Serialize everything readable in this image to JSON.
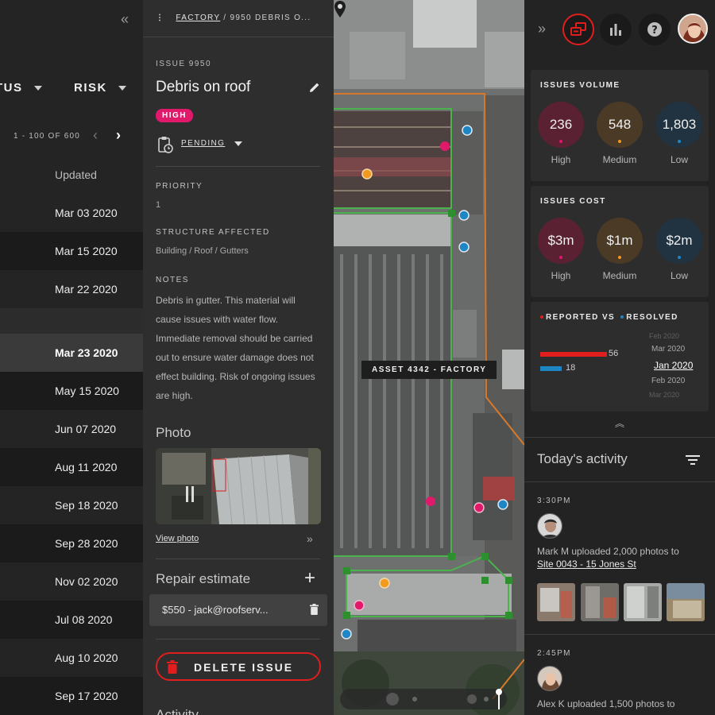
{
  "table": {
    "collapse_icon": "double-chevron-left-icon",
    "columns": [
      "TUS",
      "RISK"
    ],
    "pager_text": "1 - 100 OF 600",
    "updated_header": "Updated",
    "rows": [
      "Mar 03 2020",
      "Mar 15  2020",
      "Mar 22 2020",
      "",
      "Mar 23 2020",
      "May 15 2020",
      "Jun 07 2020",
      "Aug 11 2020",
      "Sep 18 2020",
      "Sep 28 2020",
      "Nov 02 2020",
      "Jul 08 2020",
      "Aug 10 2020",
      "Sep 17 2020"
    ],
    "selected_row": "Mar 23 2020"
  },
  "issue": {
    "breadcrumb_root": "FACTORY",
    "breadcrumb_current": "/ 9950 DEBRIS O...",
    "number": "ISSUE 9950",
    "title": "Debris on roof",
    "risk_badge": "HIGH",
    "status": "PENDING",
    "priority_label": "PRIORITY",
    "priority_value": "1",
    "structure_label": "STRUCTURE AFFECTED",
    "structure_value": "Building / Roof / Gutters",
    "notes_label": "NOTES",
    "notes": "Debris in gutter. This material will cause issues with water flow. Immediate removal should be carried out to ensure water damage does not effect building. Risk of ongoing issues are high.",
    "photo_heading": "Photo",
    "view_photo": "View photo",
    "repair_heading": "Repair estimate",
    "repair_item": "$550 - jack@roofserv...",
    "delete_label": "DELETE ISSUE",
    "activity_heading": "Activity"
  },
  "map": {
    "asset_label": "ASSET 4342 - FACTORY"
  },
  "dashboard": {
    "volume": {
      "title": "ISSUES VOLUME",
      "items": [
        {
          "value": "236",
          "label": "High",
          "color": "#e0196b"
        },
        {
          "value": "548",
          "label": "Medium",
          "color": "#f29a1f"
        },
        {
          "value": "1,803",
          "label": "Low",
          "color": "#1f86c6"
        }
      ]
    },
    "cost": {
      "title": "ISSUES COST",
      "items": [
        {
          "value": "$3m",
          "label": "High",
          "color": "#e0196b"
        },
        {
          "value": "$1m",
          "label": "Medium",
          "color": "#f29a1f"
        },
        {
          "value": "$2m",
          "label": "Low",
          "color": "#1f86c6"
        }
      ]
    },
    "reported": {
      "title_reported": "REPORTED VS",
      "title_resolved": "RESOLVED",
      "reported_value": "56",
      "resolved_value": "18",
      "reported_fraction": 0.54,
      "resolved_fraction": 0.17,
      "months": [
        "Feb 2020",
        "Mar 2020",
        "Jan 2020",
        "Feb 2020",
        "Mar 2020"
      ],
      "selected_month": "Jan 2020"
    }
  },
  "activity": {
    "heading": "Today's activity",
    "entries": [
      {
        "time": "3:30PM",
        "text": "Mark M uploaded 2,000 photos to",
        "link": "Site 0043 - 15 Jones St"
      },
      {
        "time": "2:45PM",
        "text": "Alex K uploaded 1,500 photos to",
        "link": ""
      }
    ]
  }
}
